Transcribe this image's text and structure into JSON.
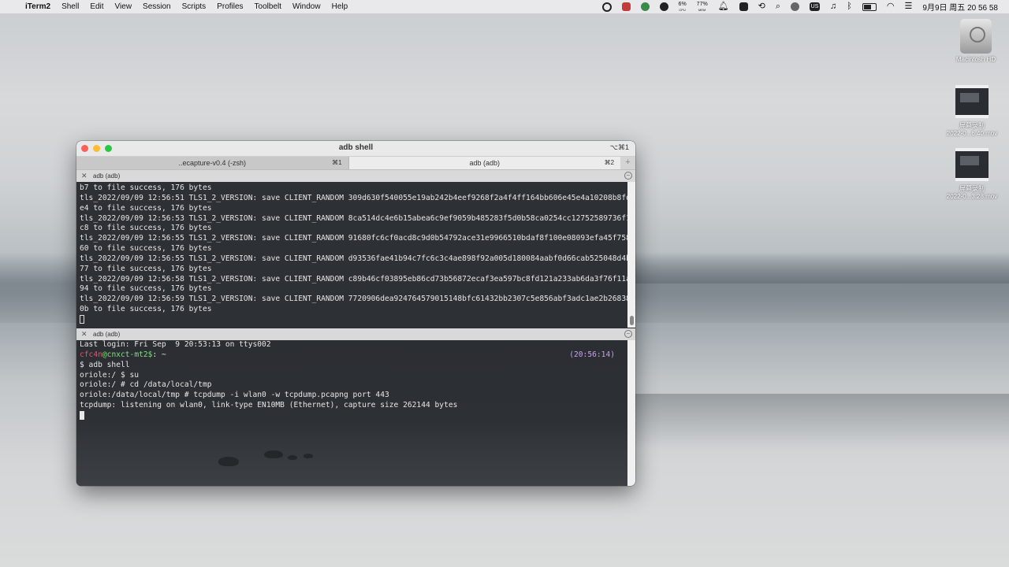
{
  "menubar": {
    "app": "iTerm2",
    "items": [
      "Shell",
      "Edit",
      "View",
      "Session",
      "Scripts",
      "Profiles",
      "Toolbelt",
      "Window",
      "Help"
    ],
    "cpu": "6%",
    "cpu_label": "CPU",
    "mem": "77%",
    "mem_label": "MEM",
    "input_source": "US",
    "clock": "9月9日 周五  20 56 58"
  },
  "desktop": {
    "icons": [
      {
        "name": "hard-drive",
        "label": "Macintosh HD"
      },
      {
        "name": "movie-1",
        "label1": "屏幕录制",
        "label2": "2022-0...6.40.mov"
      },
      {
        "name": "movie-2",
        "label1": "屏幕录制",
        "label2": "2022-0...3.28.mov"
      }
    ]
  },
  "window": {
    "title": "adb shell",
    "shortcut": "⌥⌘1",
    "tabs": [
      {
        "label": "..ecapture-v0.4 (-zsh)",
        "key": "⌘1",
        "active": false
      },
      {
        "label": "adb (adb)",
        "key": "⌘2",
        "active": true
      }
    ],
    "tab_add": "+",
    "pane1": {
      "header": "adb (adb)",
      "lines": [
        "b7 to file success, 176 bytes",
        "tls_2022/09/09 12:56:51 TLS1_2_VERSION: save CLIENT_RANDOM 309d630f540055e19ab242b4eef9268f2a4f4ff164bb606e45e4a10208b8fd",
        "e4 to file success, 176 bytes",
        "tls_2022/09/09 12:56:53 TLS1_2_VERSION: save CLIENT_RANDOM 8ca514dc4e6b15abea6c9ef9059b485283f5d0b58ca0254cc12752589736f1",
        "c8 to file success, 176 bytes",
        "tls_2022/09/09 12:56:55 TLS1_2_VERSION: save CLIENT_RANDOM 91680fc6cf0acd8c9d0b54792ace31e9966510bdaf8f100e08093efa45f758",
        "60 to file success, 176 bytes",
        "tls_2022/09/09 12:56:55 TLS1_2_VERSION: save CLIENT_RANDOM d93536fae41b94c7fc6c3c4ae898f92a005d180084aabf0d66cab525048d4b",
        "77 to file success, 176 bytes",
        "tls_2022/09/09 12:56:58 TLS1_2_VERSION: save CLIENT_RANDOM c89b46cf03895eb86cd73b56872ecaf3ea597bc8fd121a233ab6da3f76f11a",
        "94 to file success, 176 bytes",
        "tls_2022/09/09 12:56:59 TLS1_2_VERSION: save CLIENT_RANDOM 7720906dea924764579015148bfc61432bb2307c5e856abf3adc1ae2b26838",
        "0b to file success, 176 bytes"
      ]
    },
    "pane2": {
      "header": "adb (adb)",
      "last_login": "Last login: Fri Sep  9 20:53:13 on ttys002",
      "prompt_user": "cfc4n",
      "prompt_host": "@cnxct-mt2$",
      "prompt_path": ": ~",
      "timestamp": "(20:56:14)",
      "lines": [
        "$ adb shell",
        "oriole:/ $ su",
        "oriole:/ # cd /data/local/tmp",
        "oriole:/data/local/tmp # tcpdump -i wlan0 -w tcpdump.pcapng port 443",
        "tcpdump: listening on wlan0, link-type EN10MB (Ethernet), capture size 262144 bytes"
      ]
    }
  }
}
